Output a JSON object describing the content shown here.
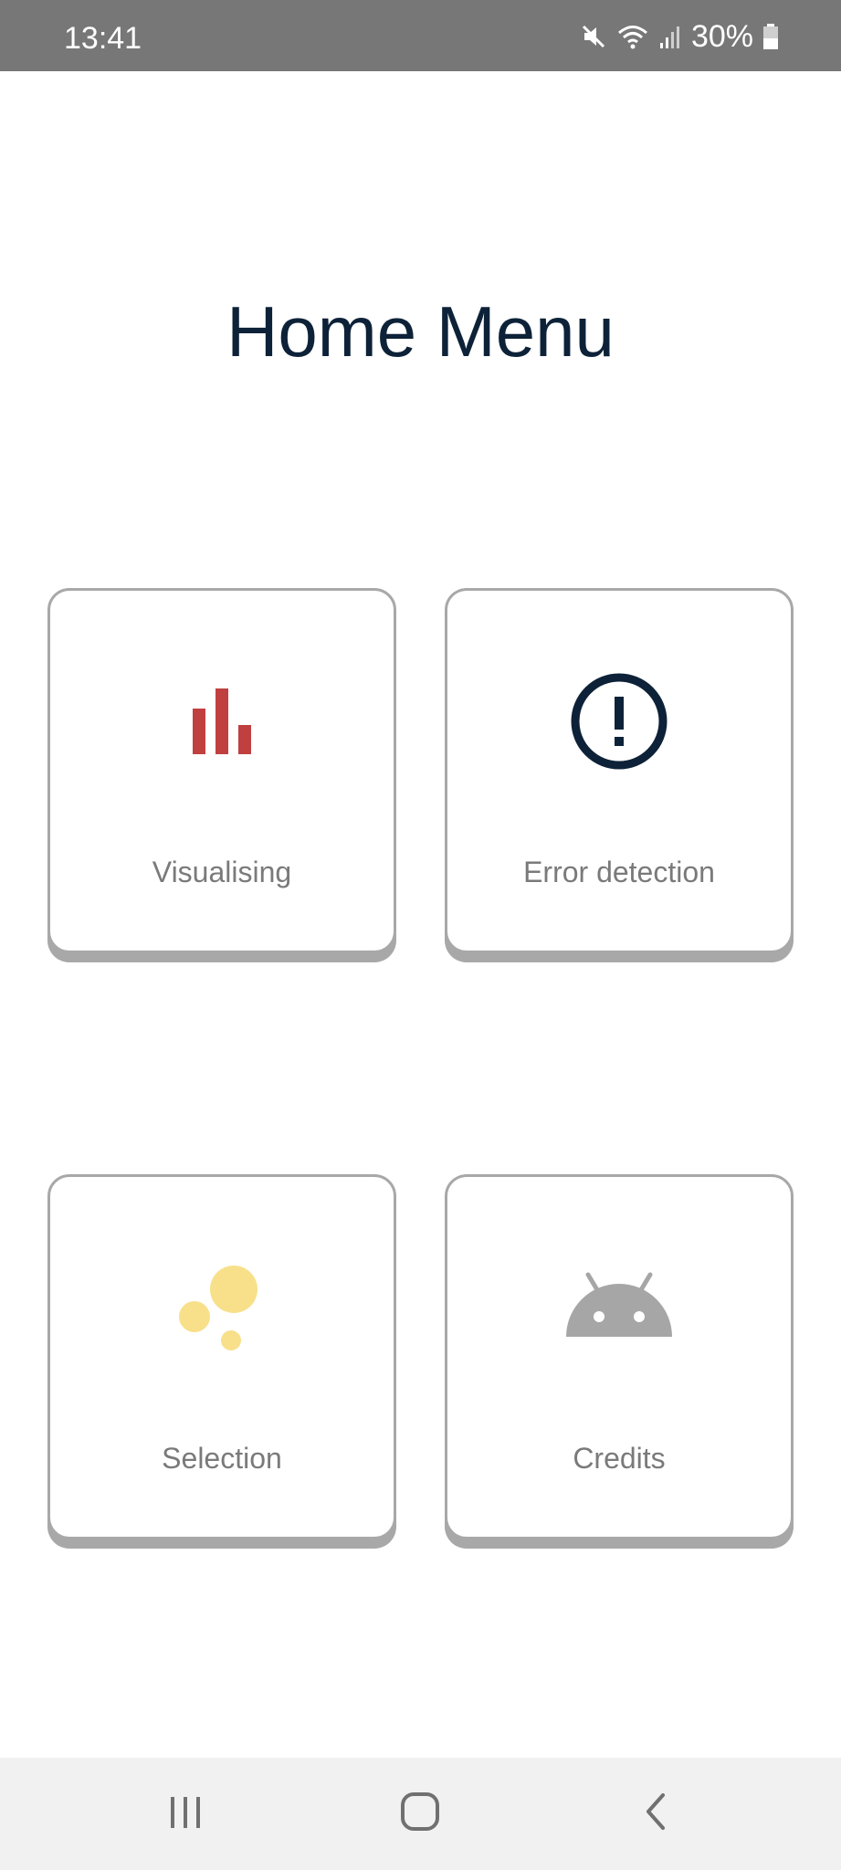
{
  "status_bar": {
    "time": "13:41",
    "battery": "30%",
    "icons": [
      "mute-icon",
      "wifi-icon",
      "signal-icon",
      "battery-icon"
    ]
  },
  "page": {
    "title": "Home Menu"
  },
  "cards": [
    {
      "label": "Visualising",
      "icon": "bar-chart-icon",
      "icon_color": "#c04040"
    },
    {
      "label": "Error detection",
      "icon": "exclamation-circle-icon",
      "icon_color": "#0d2238"
    },
    {
      "label": "Selection",
      "icon": "bubbles-icon",
      "icon_color": "#f8e08a"
    },
    {
      "label": "Credits",
      "icon": "android-icon",
      "icon_color": "#a6a6a6"
    }
  ],
  "nav_bar": {
    "icons": [
      "recents-icon",
      "home-icon",
      "back-icon"
    ]
  },
  "colors": {
    "status_bar_bg": "#777777",
    "title_text": "#0d2238",
    "card_border": "#a8a8a8",
    "label_text": "#7a7a7a",
    "nav_bar_bg": "#f1f1f1"
  }
}
